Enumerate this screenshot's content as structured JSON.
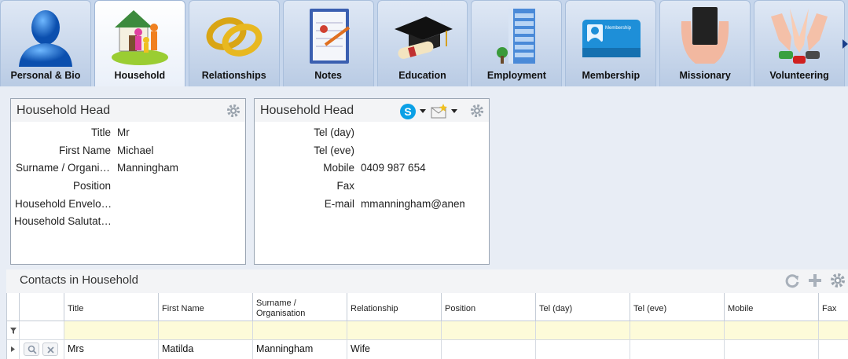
{
  "tabs": [
    {
      "label": "Personal & Bio",
      "icon": "person-silhouette-icon",
      "active": false
    },
    {
      "label": "Household",
      "icon": "house-family-icon",
      "active": true
    },
    {
      "label": "Relationships",
      "icon": "wedding-rings-icon",
      "active": false
    },
    {
      "label": "Notes",
      "icon": "notepad-icon",
      "active": false
    },
    {
      "label": "Education",
      "icon": "graduation-cap-icon",
      "active": false
    },
    {
      "label": "Employment",
      "icon": "office-building-icon",
      "active": false
    },
    {
      "label": "Membership",
      "icon": "membership-card-icon",
      "active": false
    },
    {
      "label": "Missionary",
      "icon": "hands-bible-icon",
      "active": false
    },
    {
      "label": "Volunteering",
      "icon": "raised-hands-icon",
      "active": false
    }
  ],
  "membership_card_text": "Membership",
  "left_panel": {
    "title": "Household Head",
    "fields": [
      {
        "label": "Title",
        "value": "Mr"
      },
      {
        "label": "First Name",
        "value": "Michael"
      },
      {
        "label": "Surname / Organi…",
        "value": "Manningham"
      },
      {
        "label": "Position",
        "value": ""
      },
      {
        "label": "Household Envelo…",
        "value": ""
      },
      {
        "label": "Household Salutat…",
        "value": ""
      }
    ]
  },
  "right_panel": {
    "title": "Household Head",
    "fields": [
      {
        "label": "Tel (day)",
        "value": ""
      },
      {
        "label": "Tel (eve)",
        "value": ""
      },
      {
        "label": "Mobile",
        "value": "0409 987 654"
      },
      {
        "label": "Fax",
        "value": ""
      },
      {
        "label": "E-mail",
        "value": "mmanningham@anem"
      }
    ]
  },
  "contacts": {
    "title": "Contacts in Household",
    "columns": [
      "Title",
      "First Name",
      "Surname / Organisation",
      "Relationship",
      "Position",
      "Tel (day)",
      "Tel (eve)",
      "Mobile",
      "Fax"
    ],
    "rows": [
      {
        "title": "Mrs",
        "first_name": "Matilda",
        "surname": "Manningham",
        "relationship": "Wife",
        "position": "",
        "tel_day": "",
        "tel_eve": "",
        "mobile": "",
        "fax": ""
      }
    ]
  },
  "colors": {
    "tab_active": "#ffffff",
    "tab_inactive": "#c9d8ee",
    "filter_row": "#fdfbd9",
    "accent_blue": "#2a6ecc"
  }
}
